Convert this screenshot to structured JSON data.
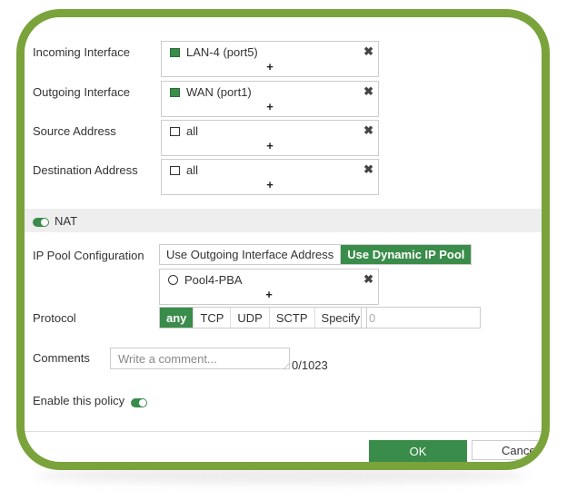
{
  "incoming": {
    "label": "Incoming Interface",
    "value": "LAN-4 (port5)"
  },
  "outgoing": {
    "label": "Outgoing Interface",
    "value": "WAN (port1)"
  },
  "source": {
    "label": "Source Address",
    "value": "all"
  },
  "destination": {
    "label": "Destination Address",
    "value": "all"
  },
  "add_symbol": "+",
  "remove_symbol": "✖",
  "nat": {
    "label": "NAT",
    "enabled": true
  },
  "ip_pool": {
    "label": "IP Pool Configuration",
    "options": [
      "Use Outgoing Interface Address",
      "Use Dynamic IP Pool"
    ],
    "selected": "Use Dynamic IP Pool",
    "value": "Pool4-PBA"
  },
  "protocol": {
    "label": "Protocol",
    "options": [
      "any",
      "TCP",
      "UDP",
      "SCTP",
      "Specify"
    ],
    "selected": "any",
    "port_value": "0"
  },
  "comments": {
    "label": "Comments",
    "placeholder": "Write a comment...",
    "counter": "0/1023"
  },
  "enable_policy": {
    "label": "Enable this policy",
    "enabled": true
  },
  "buttons": {
    "ok": "OK",
    "cancel": "Cancel"
  },
  "colors": {
    "accent": "#3a8c4a",
    "frame": "#7aa33b"
  }
}
